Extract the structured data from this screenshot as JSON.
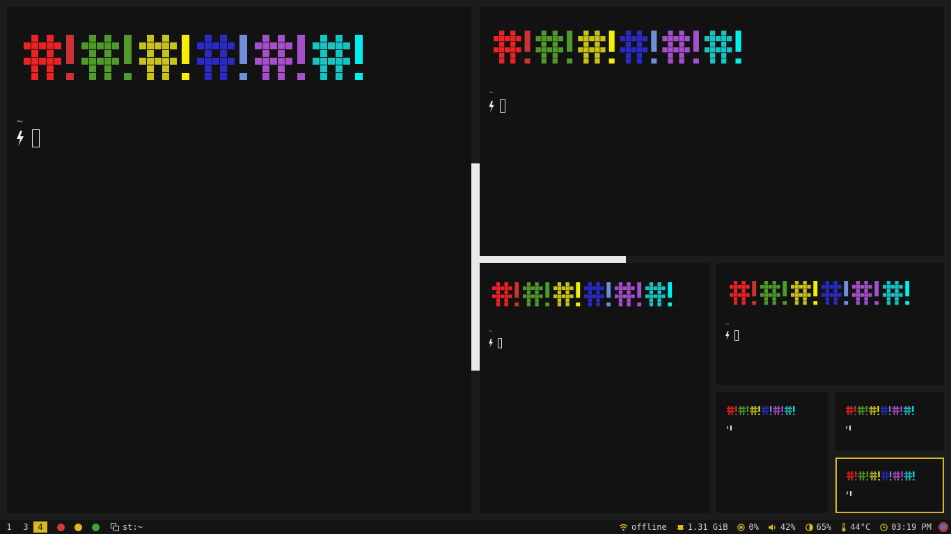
{
  "banner": {
    "colors": {
      "red": "#ee2222",
      "red_bang": "#cc3333",
      "green": "#4f9a2a",
      "green_bang": "#4f9a2a",
      "yellow": "#c9c21a",
      "yellow_bang": "#f5f000",
      "blue": "#2a2ac8",
      "blue_bang": "#6f8fdd",
      "purple": "#a64fcc",
      "purple_bang": "#a64fcc",
      "cyan": "#17c4c4",
      "cyan_bang": "#00f0f0"
    }
  },
  "terminals": [
    {
      "id": "term-large-left",
      "prompt_tilde": "~",
      "focused": false
    },
    {
      "id": "term-top-right",
      "prompt_tilde": "~",
      "focused": false
    },
    {
      "id": "term-mid-left",
      "prompt_tilde": "~",
      "focused": false
    },
    {
      "id": "term-mid-right",
      "prompt_tilde": "~",
      "focused": false
    },
    {
      "id": "term-small-1",
      "prompt_tilde": "",
      "focused": false
    },
    {
      "id": "term-small-2",
      "prompt_tilde": "",
      "focused": false
    },
    {
      "id": "term-small-3",
      "prompt_tilde": "",
      "focused": true
    }
  ],
  "statusbar": {
    "workspaces": [
      "1",
      "3",
      "4"
    ],
    "active_workspace": "4",
    "window_buttons": {
      "close": "#d63a3a",
      "minimize": "#d9b91c",
      "maximize": "#3fa43f"
    },
    "window_icon": "window-stack-icon",
    "window_title": "st:~",
    "wifi_icon": "wifi-icon",
    "network": "offline",
    "memory_icon": "memory-chip-icon",
    "memory": "1.31 GiB",
    "cpu_icon": "cpu-icon",
    "cpu": "0%",
    "volume_icon": "speaker-icon",
    "volume": "42%",
    "brightness_icon": "brightness-icon",
    "brightness": "65%",
    "temp_icon": "thermometer-icon",
    "temperature": "44°C",
    "clock_icon": "clock-icon",
    "time": "03:19 PM",
    "tray_icon": "app-tray-icon"
  }
}
